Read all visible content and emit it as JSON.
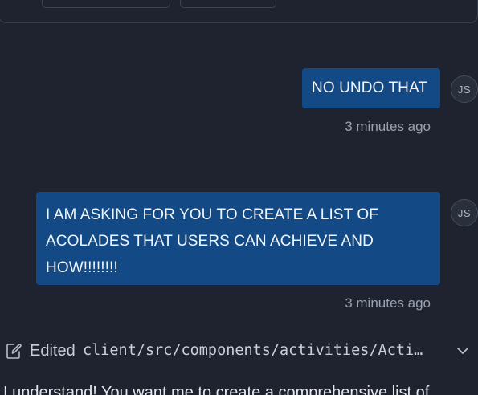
{
  "messages": [
    {
      "role": "user",
      "text": "NO UNDO THAT",
      "avatar": "JS",
      "time": "3 minutes ago"
    },
    {
      "role": "user",
      "text": "I AM ASKING FOR YOU TO CREATE A LIST OF ACOLADES THAT USERS CAN ACHIEVE AND HOW!!!!!!!!",
      "avatar": "JS",
      "time": "3 minutes ago"
    }
  ],
  "edit": {
    "label": "Edited",
    "path": "client/src/components/activities/Acti…",
    "icon": "edit-file-icon",
    "toggle_icon": "chevron-down-icon"
  },
  "assistant": {
    "text": "I understand! You want me to create a comprehensive list of"
  },
  "colors": {
    "background": "#1f2330",
    "user_bubble": "#134a86",
    "muted_text": "#9aa1b0"
  }
}
